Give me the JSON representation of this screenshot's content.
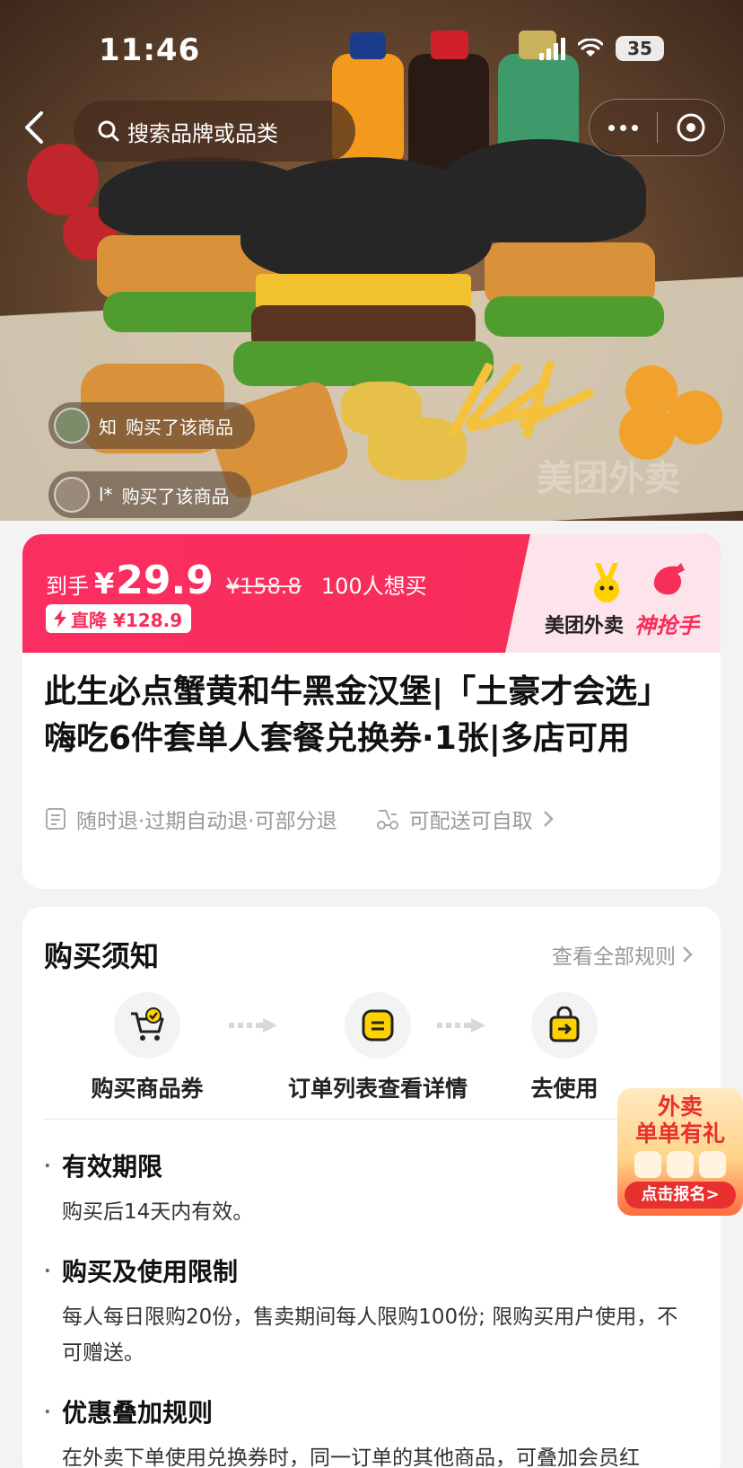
{
  "status_bar": {
    "time": "11:46",
    "battery": "35"
  },
  "nav": {
    "search_placeholder": "搜索品牌或品类"
  },
  "hero": {
    "buyers": [
      {
        "name": "知",
        "action": "购买了该商品"
      },
      {
        "name": "l*",
        "action": "购买了该商品"
      }
    ],
    "watermark": "美团外卖"
  },
  "price": {
    "label": "到手",
    "currency": "¥",
    "amount": "29.9",
    "original": "¥158.8",
    "want_count": "100人想买",
    "drop_badge": "直降 ¥128.9",
    "brand_name": "美团外卖",
    "brand_slogan": "神抢手"
  },
  "product": {
    "title": "此生必点蟹黄和牛黑金汉堡|「土豪才会选」嗨吃6件套单人套餐兑换券·1张|多店可用",
    "refund_policy": "随时退·过期自动退·可部分退",
    "delivery": "可配送可自取"
  },
  "notice": {
    "title": "购买须知",
    "rules_link": "查看全部规则",
    "steps": [
      {
        "label": "购买商品券",
        "icon": "cart-check-icon"
      },
      {
        "label": "订单列表查看详情",
        "icon": "list-icon"
      },
      {
        "label": "去使用",
        "icon": "bag-arrow-icon"
      }
    ],
    "sections": [
      {
        "heading": "有效期限",
        "body": "购买后14天内有效。"
      },
      {
        "heading": "购买及使用限制",
        "body": "每人每日限购20份，售卖期间每人限购100份; 限购买用户使用，不可赠送。"
      },
      {
        "heading": "优惠叠加规则",
        "body": "在外卖下单使用兑换券时，同一订单的其他商品，可叠加会员红"
      }
    ]
  },
  "promo": {
    "line1": "外卖",
    "line2": "单单有礼",
    "button": "点击报名>"
  },
  "colors": {
    "accent": "#f72d5a",
    "brand_yellow": "#ffd100",
    "background": "#f3f3f3"
  }
}
